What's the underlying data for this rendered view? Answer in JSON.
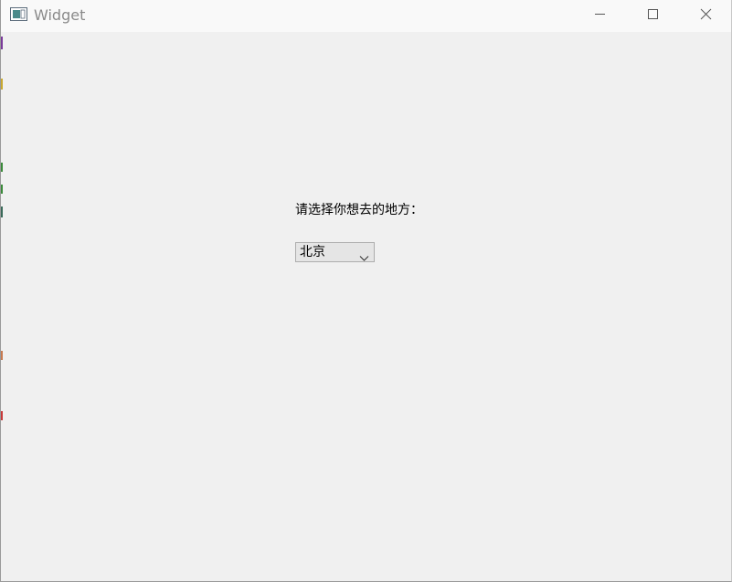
{
  "window": {
    "title": "Widget",
    "icon": "window-icon",
    "controls": {
      "minimize_icon": "minimize-icon",
      "maximize_icon": "maximize-icon",
      "close_icon": "close-icon"
    }
  },
  "form": {
    "prompt_label": "请选择你想去的地方：",
    "destination_combo": {
      "selected_value": "北京",
      "arrow_icon": "chevron-down-icon"
    }
  },
  "colors": {
    "client_background": "#f0f0f0",
    "titlebar_background": "#f9f9f9",
    "title_text": "#8a8a8a",
    "combo_background": "#e5e5e5",
    "combo_border": "#adadad"
  }
}
